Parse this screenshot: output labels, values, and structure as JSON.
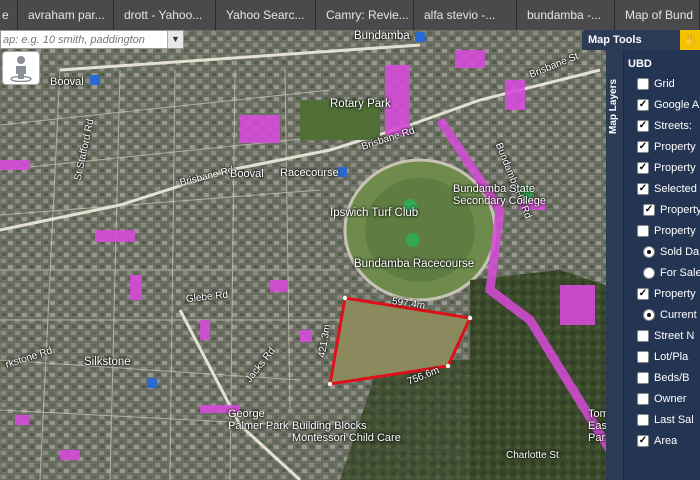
{
  "browser": {
    "tabs": [
      {
        "label": "e"
      },
      {
        "label": "avraham par..."
      },
      {
        "label": "drott - Yahoo..."
      },
      {
        "label": "Yahoo Searc..."
      },
      {
        "label": "Camry: Revie..."
      },
      {
        "label": "alfa stevio -..."
      },
      {
        "label": "bundamba -..."
      },
      {
        "label": "Map of Bund"
      }
    ]
  },
  "search": {
    "placeholder": "ap: e.g. 10 smith, paddington"
  },
  "map_tools": {
    "label": "Map Tools"
  },
  "layers": {
    "tab_label": "Map Layers",
    "header": "UBD",
    "items": [
      {
        "label": "Grid",
        "kind": "checkbox",
        "checked": false
      },
      {
        "label": "Google A",
        "kind": "checkbox",
        "checked": true
      },
      {
        "label": "Streets:",
        "kind": "checkbox",
        "checked": true
      },
      {
        "label": "Property",
        "kind": "checkbox",
        "checked": true
      },
      {
        "label": "Property",
        "kind": "checkbox",
        "checked": true
      },
      {
        "label": "Selected",
        "kind": "checkbox",
        "checked": true
      },
      {
        "label": "Property",
        "kind": "checkbox",
        "checked": true
      },
      {
        "label": "Property",
        "kind": "checkbox",
        "checked": false
      },
      {
        "label": "Sold Da",
        "kind": "radio",
        "checked": true
      },
      {
        "label": "For Sale",
        "kind": "radio",
        "checked": false
      },
      {
        "label": "Property",
        "kind": "checkbox",
        "checked": true
      },
      {
        "label": "Current",
        "kind": "radio",
        "checked": true
      },
      {
        "label": "Street N",
        "kind": "checkbox",
        "checked": false
      },
      {
        "label": "Lot/Pla",
        "kind": "checkbox",
        "checked": false
      },
      {
        "label": "Beds/B",
        "kind": "checkbox",
        "checked": false
      },
      {
        "label": "Owner",
        "kind": "checkbox",
        "checked": false
      },
      {
        "label": "Last Sal",
        "kind": "checkbox",
        "checked": false
      },
      {
        "label": "Area",
        "kind": "checkbox",
        "checked": true
      }
    ]
  },
  "map": {
    "labels": {
      "bundamba_top": "Bundamba",
      "booval_nw": "Booval",
      "brisbane_rd_e": "Brisbane Rd",
      "brisbane_st": "Brisbane St",
      "rotary_park": "Rotary Park",
      "stafford_st": "St Stafford Rd",
      "brisbane_rd_w": "Brisbane Rd",
      "booval": "Booval",
      "racecourse": "Racecourse",
      "bundamba_hill": "Bundamba Hill Rd",
      "bundamba_school": "Bundamba State Secondary College",
      "turf_club": "Ipswich Turf Club",
      "racecourse_name": "Bundamba Racecourse",
      "glebe_rd": "Glebe Rd",
      "dim_top": "597.4m",
      "dim_left": "421.3m",
      "dim_bottom": "756.6m",
      "silkstone": "Silkstone",
      "larkstone_rd": "rkstone Rd",
      "jacks_rd": "Jacks Rd",
      "george_palmer": "George Palmer Park",
      "building_blocks": "Building Blocks Montessori Child Care",
      "charlotte_st": "Charlotte St",
      "tom_park": "Tom Easterbrook Park"
    },
    "colors": {
      "parcel_highlight": "#d64bd8",
      "selected_outline": "#e0101a",
      "place_pin": "#34a853"
    }
  }
}
